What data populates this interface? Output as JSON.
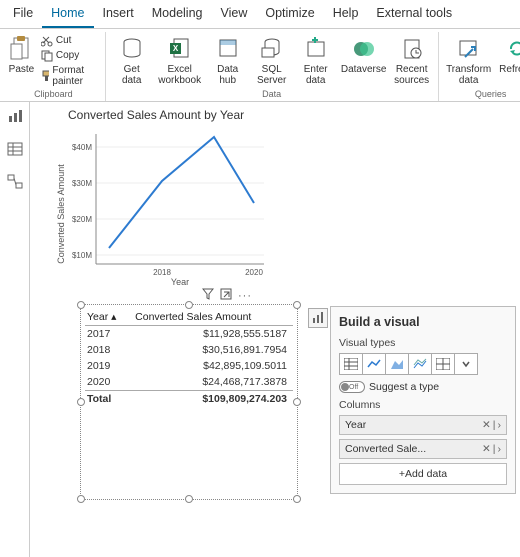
{
  "menubar": {
    "tabs": [
      {
        "label": "File"
      },
      {
        "label": "Home"
      },
      {
        "label": "Insert"
      },
      {
        "label": "Modeling"
      },
      {
        "label": "View"
      },
      {
        "label": "Optimize"
      },
      {
        "label": "Help"
      },
      {
        "label": "External tools"
      }
    ],
    "active_index": 1
  },
  "ribbon": {
    "clipboard": {
      "paste": "Paste",
      "cut": "Cut",
      "copy": "Copy",
      "format_painter": "Format painter",
      "group_label": "Clipboard"
    },
    "data": {
      "get_data": "Get\ndata",
      "excel": "Excel\nworkbook",
      "data_hub": "Data\nhub",
      "sql": "SQL\nServer",
      "enter": "Enter\ndata",
      "dataverse": "Dataverse",
      "recent": "Recent\nsources",
      "group_label": "Data"
    },
    "queries": {
      "transform": "Transform\ndata",
      "refresh": "Refresh",
      "group_label": "Queries"
    }
  },
  "sidetools": {
    "items": [
      "report-view",
      "table-view",
      "model-view"
    ]
  },
  "chart": {
    "title": "Converted Sales Amount by Year",
    "ylabel": "Converted Sales Amount",
    "xlabel": "Year",
    "yticks": [
      "$40M",
      "$30M",
      "$20M",
      "$10M"
    ],
    "xticks": [
      "2018",
      "2020"
    ]
  },
  "chart_data": {
    "type": "line",
    "title": "Converted Sales Amount by Year",
    "xlabel": "Year",
    "ylabel": "Converted Sales Amount",
    "categories": [
      "2017",
      "2018",
      "2019",
      "2020"
    ],
    "values": [
      11928555.5187,
      30516891.7954,
      42895109.5011,
      24468717.3878
    ],
    "y_ticks_display": [
      "$10M",
      "$20M",
      "$30M",
      "$40M"
    ],
    "total_display": "$109,809,274.203"
  },
  "table": {
    "cols": [
      "Year",
      "Converted Sales Amount"
    ],
    "rows": [
      {
        "year": "2017",
        "amount": "$11,928,555.5187"
      },
      {
        "year": "2018",
        "amount": "$30,516,891.7954"
      },
      {
        "year": "2019",
        "amount": "$42,895,109.5011"
      },
      {
        "year": "2020",
        "amount": "$24,468,717.3878"
      }
    ],
    "total_label": "Total",
    "total_value": "$109,809,274.203"
  },
  "build_visual": {
    "title": "Build a visual",
    "visual_types_label": "Visual types",
    "suggest_label": "Suggest a type",
    "toggle_state": "Off",
    "columns_label": "Columns",
    "columns": [
      {
        "name": "Year"
      },
      {
        "name": "Converted Sale..."
      }
    ],
    "add_data_label": "+Add data"
  }
}
